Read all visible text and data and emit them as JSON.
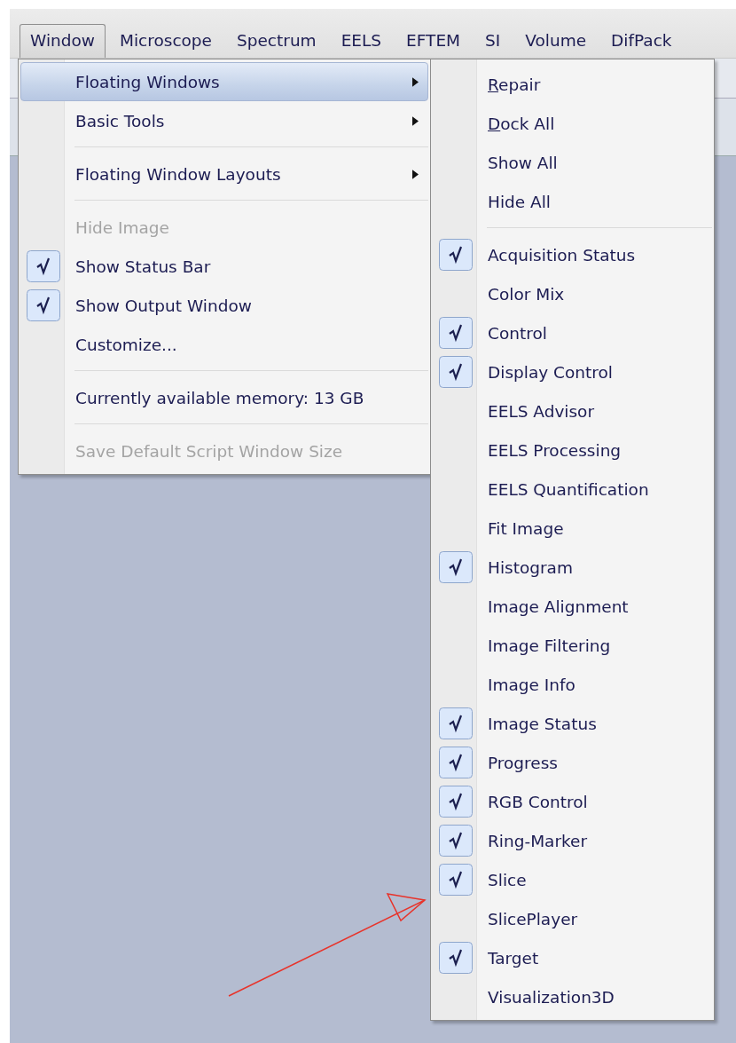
{
  "menu_bar": [
    {
      "label": "Window",
      "selected": true
    },
    {
      "label": "Microscope",
      "selected": false
    },
    {
      "label": "Spectrum",
      "selected": false
    },
    {
      "label": "EELS",
      "selected": false
    },
    {
      "label": "EFTEM",
      "selected": false
    },
    {
      "label": "SI",
      "selected": false
    },
    {
      "label": "Volume",
      "selected": false
    },
    {
      "label": "DifPack",
      "selected": false
    }
  ],
  "window_menu": {
    "items": [
      {
        "kind": "item",
        "label": "Floating Windows",
        "highlighted": true,
        "submenu": true,
        "checked": false,
        "disabled": false
      },
      {
        "kind": "item",
        "label": "Basic Tools",
        "highlighted": false,
        "submenu": true,
        "checked": false,
        "disabled": false
      },
      {
        "kind": "separator"
      },
      {
        "kind": "item",
        "label": "Floating Window Layouts",
        "highlighted": false,
        "submenu": true,
        "checked": false,
        "disabled": false
      },
      {
        "kind": "separator"
      },
      {
        "kind": "item",
        "label": "Hide Image",
        "highlighted": false,
        "submenu": false,
        "checked": false,
        "disabled": true
      },
      {
        "kind": "item",
        "label": "Show Status Bar",
        "highlighted": false,
        "submenu": false,
        "checked": true,
        "disabled": false
      },
      {
        "kind": "item",
        "label": "Show Output Window",
        "highlighted": false,
        "submenu": false,
        "checked": true,
        "disabled": false
      },
      {
        "kind": "item",
        "label": "Customize...",
        "highlighted": false,
        "submenu": false,
        "checked": false,
        "disabled": false
      },
      {
        "kind": "separator"
      },
      {
        "kind": "item",
        "label": "Currently available memory: 13 GB",
        "highlighted": false,
        "submenu": false,
        "checked": false,
        "disabled": false
      },
      {
        "kind": "separator"
      },
      {
        "kind": "item",
        "label": "Save Default Script Window Size",
        "highlighted": false,
        "submenu": false,
        "checked": false,
        "disabled": true
      }
    ]
  },
  "floating_windows_submenu": {
    "items": [
      {
        "kind": "item",
        "label": "Repair",
        "underline_first": true,
        "checked": false
      },
      {
        "kind": "item",
        "label": "Dock All",
        "underline_first": true,
        "checked": false
      },
      {
        "kind": "item",
        "label": "Show All",
        "underline_first": false,
        "checked": false
      },
      {
        "kind": "item",
        "label": "Hide All",
        "underline_first": false,
        "checked": false
      },
      {
        "kind": "separator"
      },
      {
        "kind": "item",
        "label": "Acquisition Status",
        "underline_first": false,
        "checked": true
      },
      {
        "kind": "item",
        "label": "Color Mix",
        "underline_first": false,
        "checked": false
      },
      {
        "kind": "item",
        "label": "Control",
        "underline_first": false,
        "checked": true
      },
      {
        "kind": "item",
        "label": "Display Control",
        "underline_first": false,
        "checked": true
      },
      {
        "kind": "item",
        "label": "EELS Advisor",
        "underline_first": false,
        "checked": false
      },
      {
        "kind": "item",
        "label": "EELS Processing",
        "underline_first": false,
        "checked": false
      },
      {
        "kind": "item",
        "label": "EELS Quantification",
        "underline_first": false,
        "checked": false
      },
      {
        "kind": "item",
        "label": "Fit Image",
        "underline_first": false,
        "checked": false
      },
      {
        "kind": "item",
        "label": "Histogram",
        "underline_first": false,
        "checked": true
      },
      {
        "kind": "item",
        "label": "Image Alignment",
        "underline_first": false,
        "checked": false
      },
      {
        "kind": "item",
        "label": "Image Filtering",
        "underline_first": false,
        "checked": false
      },
      {
        "kind": "item",
        "label": "Image Info",
        "underline_first": false,
        "checked": false
      },
      {
        "kind": "item",
        "label": "Image Status",
        "underline_first": false,
        "checked": true
      },
      {
        "kind": "item",
        "label": "Progress",
        "underline_first": false,
        "checked": true
      },
      {
        "kind": "item",
        "label": "RGB Control",
        "underline_first": false,
        "checked": true
      },
      {
        "kind": "item",
        "label": "Ring-Marker",
        "underline_first": false,
        "checked": true
      },
      {
        "kind": "item",
        "label": "Slice",
        "underline_first": false,
        "checked": true
      },
      {
        "kind": "item",
        "label": "SlicePlayer",
        "underline_first": false,
        "checked": false
      },
      {
        "kind": "item",
        "label": "Target",
        "underline_first": false,
        "checked": true
      },
      {
        "kind": "item",
        "label": "Visualization3D",
        "underline_first": false,
        "checked": false
      }
    ]
  },
  "annotation": {
    "kind": "arrow"
  }
}
